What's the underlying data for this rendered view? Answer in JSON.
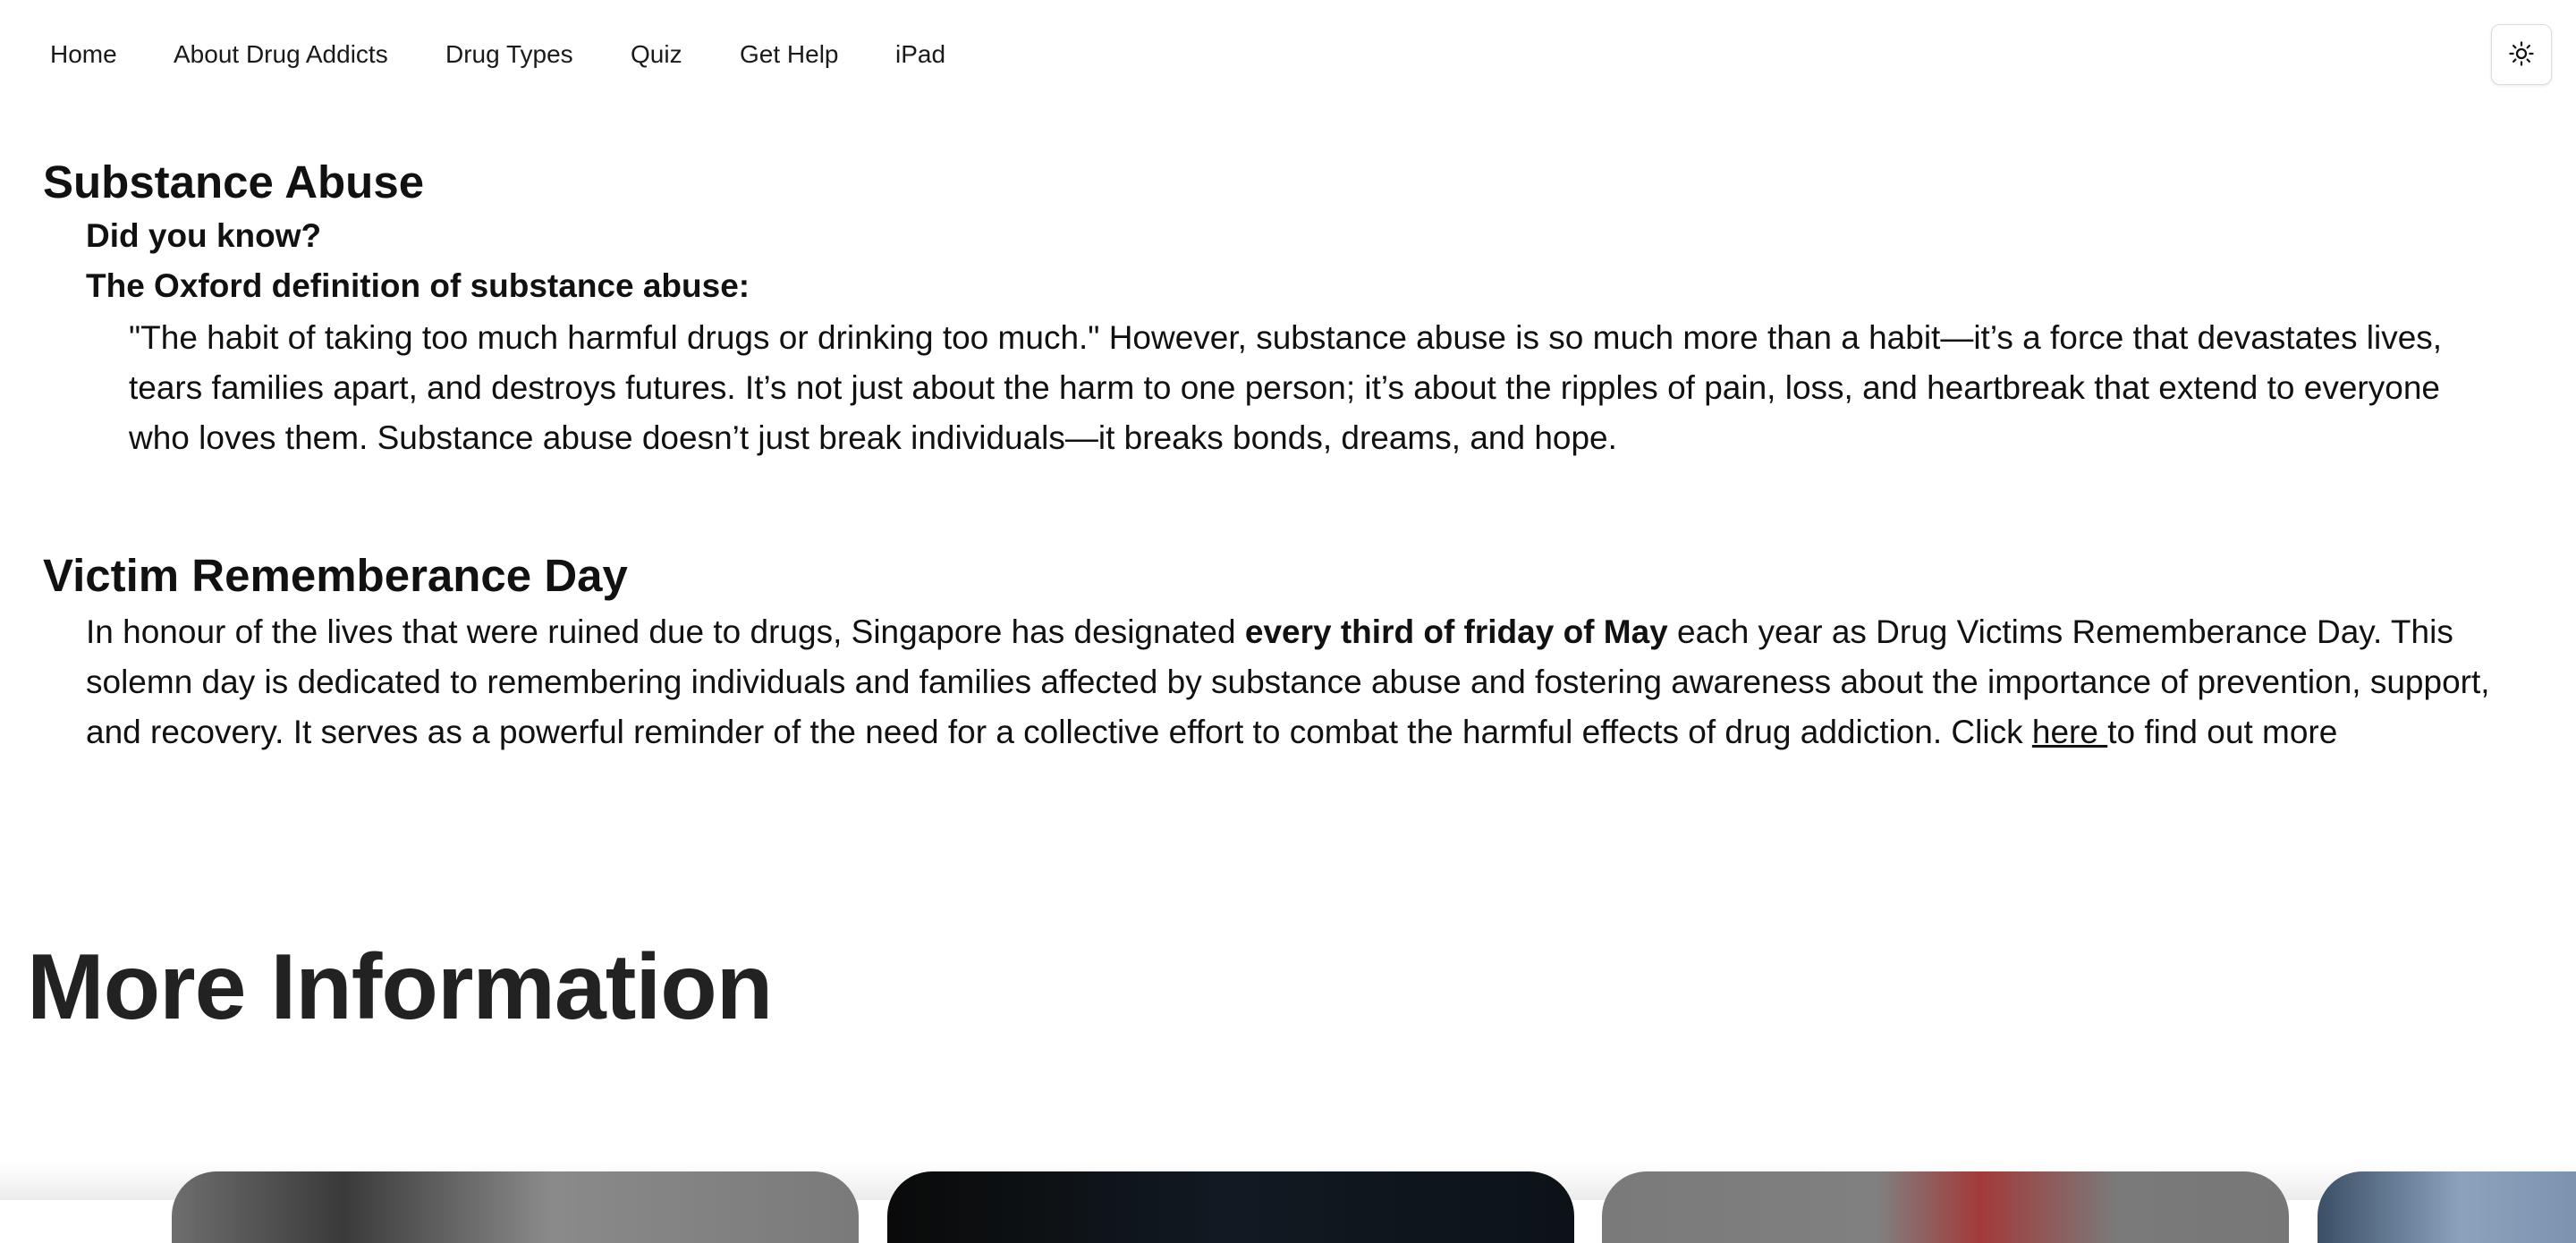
{
  "nav": {
    "items": [
      {
        "label": "Home"
      },
      {
        "label": "About Drug Addicts"
      },
      {
        "label": "Drug Types"
      },
      {
        "label": "Quiz"
      },
      {
        "label": "Get Help"
      },
      {
        "label": "iPad"
      }
    ],
    "theme_toggle_icon": "sun-icon"
  },
  "substance": {
    "title": "Substance Abuse",
    "did_you_know": "Did you know?",
    "definition_heading": "The Oxford definition of substance abuse:",
    "paragraph": "\"The habit of taking too much harmful drugs or drinking too much.\" However, substance abuse is so much more than a habit—it’s a force that devastates lives, tears families apart, and destroys futures. It’s not just about the harm to one person; it’s about the ripples of pain, loss, and heartbreak that extend to everyone who loves them. Substance abuse doesn’t just break individuals—it breaks bonds, dreams, and hope."
  },
  "victim": {
    "title": "Victim Rememberance Day",
    "text_before": "In honour of the lives that were ruined due to drugs, Singapore has designated ",
    "bold_text": "every third of friday of May",
    "text_after": " each year as Drug Victims Rememberance Day. This solemn day is dedicated to remembering individuals and families affected by substance abuse and fostering awareness about the importance of prevention, support, and recovery. It serves as a powerful reminder of the need for a collective effort to combat the harmful effects of drug addiction. Click ",
    "link_text": "here ",
    "text_end": "to find out more"
  },
  "more_info": {
    "title": "More Information"
  }
}
